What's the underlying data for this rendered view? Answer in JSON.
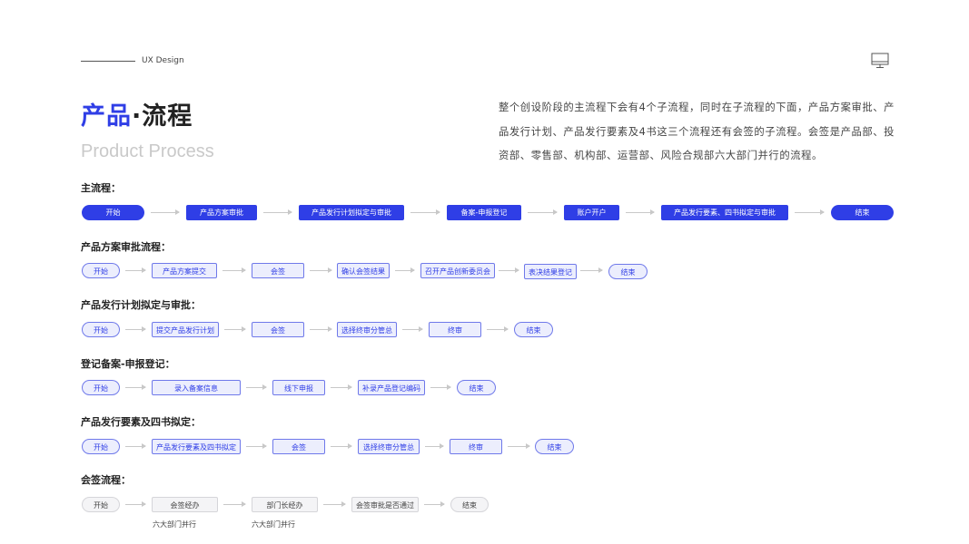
{
  "header": {
    "label": "UX Design",
    "icon": "monitor-icon"
  },
  "title": {
    "main_colored": "产品",
    "dot": "·",
    "main_dark": "流程",
    "subtitle": "Product Process"
  },
  "description": "整个创设阶段的主流程下会有4个子流程，同时在子流程的下面，产品方案审批、产品发行计划、产品发行要素及4书这三个流程还有会签的子流程。会签是产品部、投资部、零售部、机构部、运营部、风险合规部六大部门并行的流程。",
  "colors": {
    "accent": "#2f3ee6",
    "sub_fill": "#eceefd",
    "sub_border": "#6f79ea",
    "gray_fill": "#f4f4f6",
    "arrow": "#c8c8c8"
  },
  "flows": {
    "main": {
      "title": "主流程：",
      "nodes": [
        "开始",
        "产品方案审批",
        "产品发行计划拟定与审批",
        "备案-申报登记",
        "账户开户",
        "产品发行要素、四书拟定与审批",
        "结束"
      ]
    },
    "plan_approval": {
      "title": "产品方案审批流程：",
      "nodes": [
        "开始",
        "产品方案提交",
        "会签",
        "确认会签结果",
        "召开产品创新委员会",
        "表决结果登记",
        "结束"
      ]
    },
    "issue_plan": {
      "title": "产品发行计划拟定与审批：",
      "nodes": [
        "开始",
        "提交产品发行计划",
        "会签",
        "选择终审分管总",
        "终审",
        "结束"
      ]
    },
    "registration": {
      "title": "登记备案-申报登记：",
      "nodes": [
        "开始",
        "录入备案信息",
        "线下申报",
        "补录产品登记编码",
        "结束"
      ]
    },
    "issue_elements": {
      "title": "产品发行要素及四书拟定：",
      "nodes": [
        "开始",
        "产品发行要素及四书拟定",
        "会签",
        "选择终审分管总",
        "终审",
        "结束"
      ]
    },
    "countersign": {
      "title": "会签流程：",
      "nodes": [
        "开始",
        "会签经办",
        "部门长经办",
        "会签审批是否通过",
        "结束"
      ],
      "notes": [
        "六大部门并行",
        "六大部门并行"
      ]
    }
  }
}
